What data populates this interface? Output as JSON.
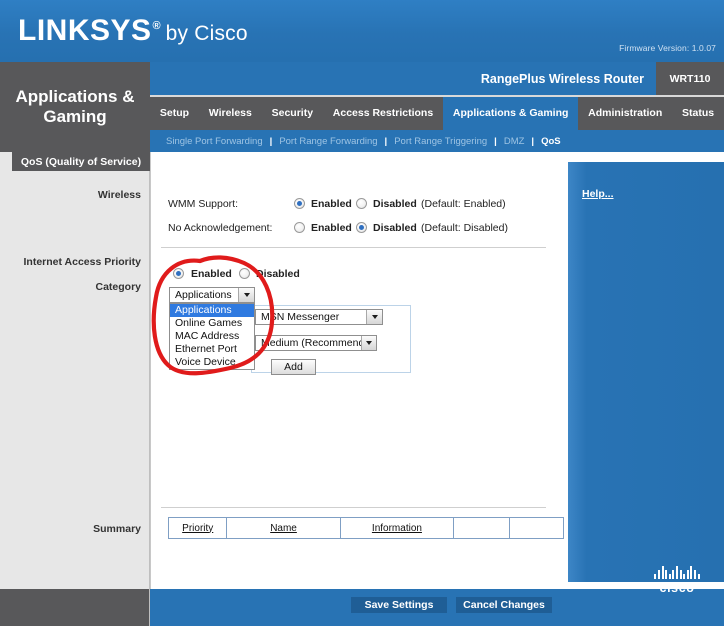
{
  "brand": {
    "logo_main": "LINKSYS",
    "logo_reg": "®",
    "logo_suffix": "by Cisco",
    "firmware": "Firmware Version: 1.0.07"
  },
  "header": {
    "page_title_line1": "Applications &",
    "page_title_line2": "Gaming",
    "model_name": "RangePlus Wireless Router",
    "model_number": "WRT110"
  },
  "tabs": [
    {
      "label": "Setup",
      "active": false
    },
    {
      "label": "Wireless",
      "active": false
    },
    {
      "label": "Security",
      "active": false
    },
    {
      "label": "Access Restrictions",
      "active": false
    },
    {
      "label": "Applications & Gaming",
      "active": true
    },
    {
      "label": "Administration",
      "active": false
    },
    {
      "label": "Status",
      "active": false
    }
  ],
  "subtabs": [
    {
      "label": "Single Port Forwarding",
      "active": false
    },
    {
      "label": "Port Range Forwarding",
      "active": false
    },
    {
      "label": "Port Range Triggering",
      "active": false
    },
    {
      "label": "DMZ",
      "active": false
    },
    {
      "label": "QoS",
      "active": true
    }
  ],
  "sidebar": {
    "section_title": "QoS (Quality of Service)",
    "label_wireless": "Wireless",
    "label_internet_access_priority": "Internet Access Priority",
    "label_category": "Category",
    "label_summary": "Summary"
  },
  "wireless": {
    "wmm_label": "WMM Support:",
    "wmm_enabled": "Enabled",
    "wmm_disabled": "Disabled",
    "wmm_default": "(Default: Enabled)",
    "wmm_selected": "Enabled",
    "noack_label": "No Acknowledgement:",
    "noack_enabled": "Enabled",
    "noack_disabled": "Disabled",
    "noack_default": "(Default: Disabled)",
    "noack_selected": "Disabled"
  },
  "internet_priority": {
    "enabled_label": "Enabled",
    "disabled_label": "Disabled",
    "selected": "Enabled"
  },
  "category": {
    "selected": "Applications",
    "open": true,
    "options": [
      "Applications",
      "Online Games",
      "MAC Address",
      "Ethernet Port",
      "Voice Device"
    ],
    "highlighted_option": "Applications"
  },
  "application_select": {
    "value": "MSN Messenger"
  },
  "priority_select": {
    "value": "Medium (Recommend)"
  },
  "add_button": {
    "label": "Add"
  },
  "summary": {
    "columns": [
      "Priority",
      "Name",
      "Information",
      "",
      ""
    ],
    "rows": []
  },
  "footer": {
    "save_label": "Save Settings",
    "cancel_label": "Cancel Changes",
    "cisco_word": "cisco"
  },
  "help": {
    "link_label": "Help..."
  },
  "colors": {
    "brand_blue": "#2873b4",
    "dark_gray": "#58585a",
    "sidebar_gray": "#e7e7e7",
    "annotation_red": "#e01b1b",
    "highlight_blue": "#2f7ae0"
  }
}
